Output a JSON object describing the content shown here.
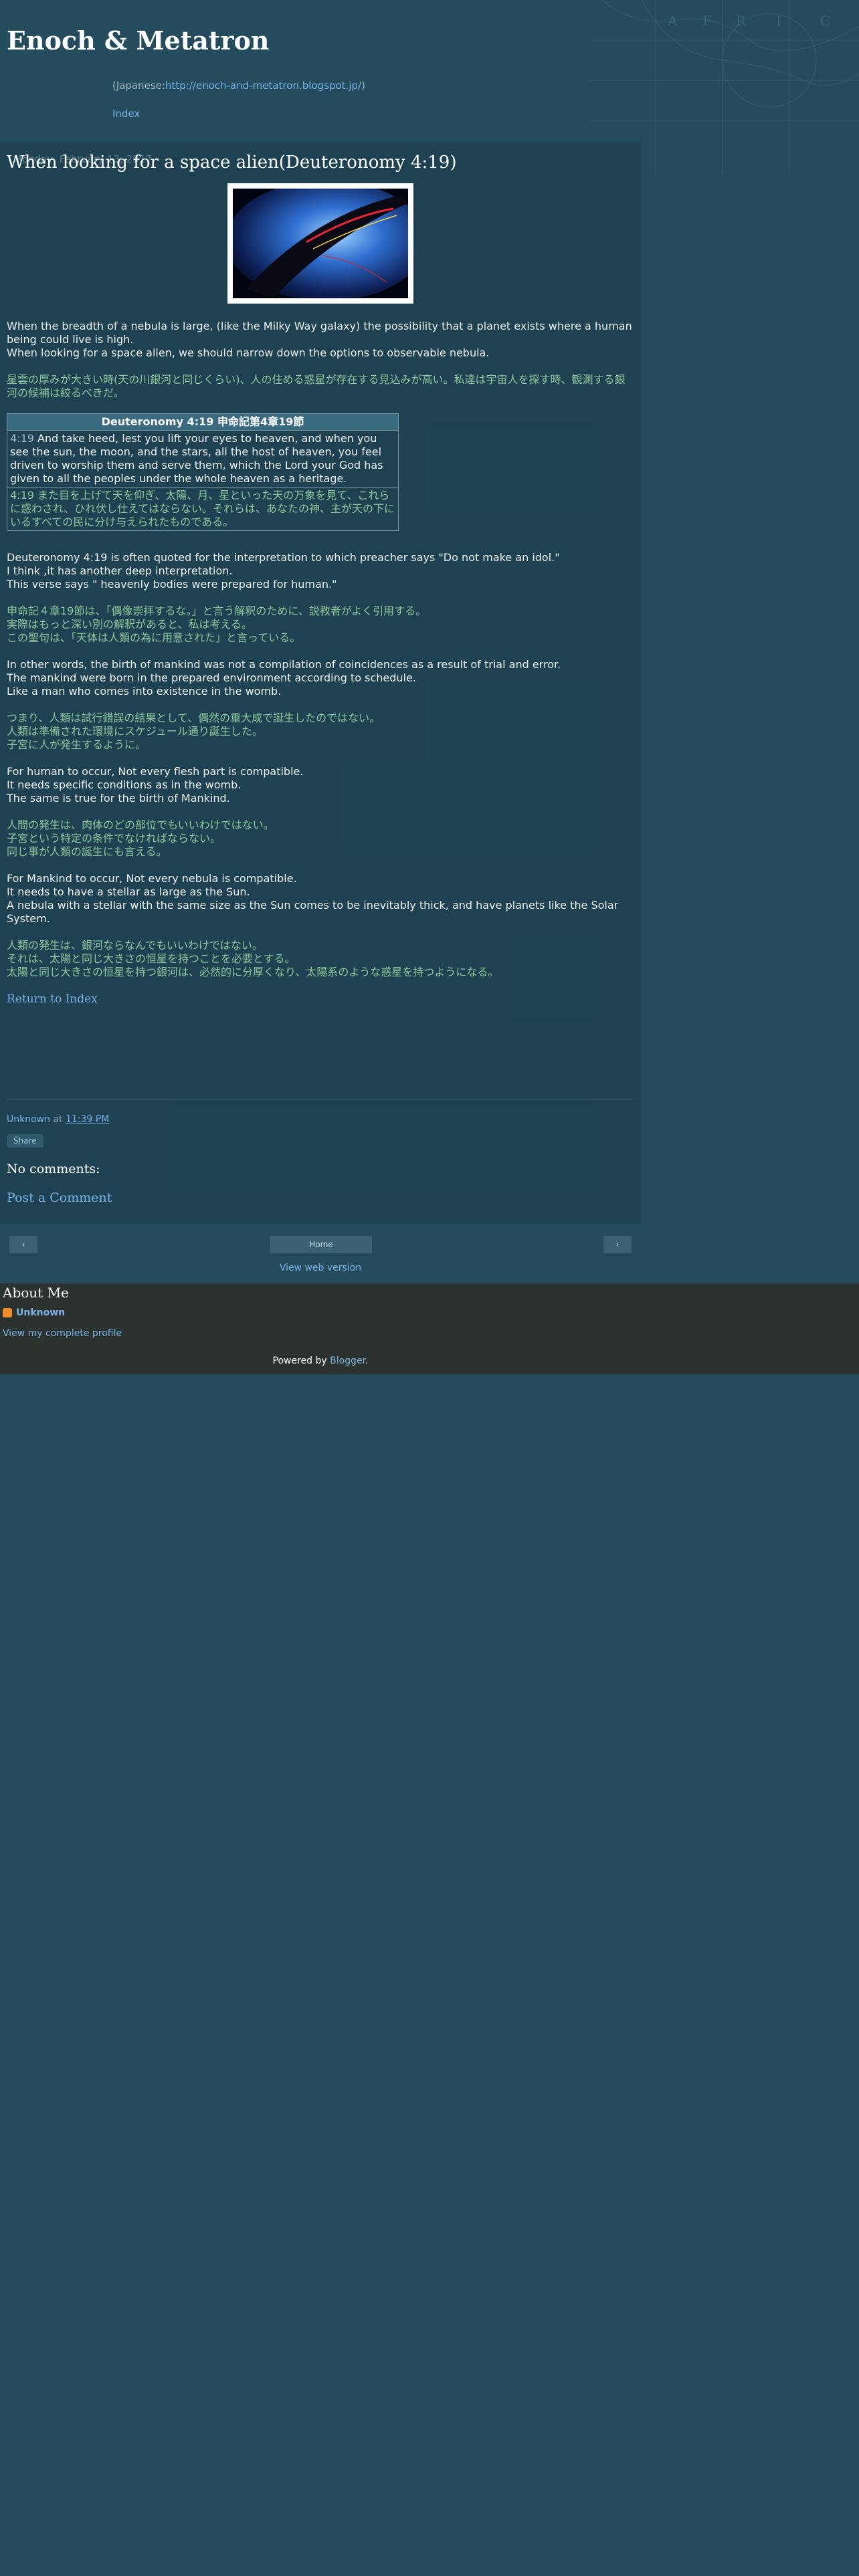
{
  "header": {
    "title": "Enoch & Metatron",
    "desc_prefix": "(Japanese:",
    "desc_link": "http://enoch-and-metatron.blogspot.jp/",
    "desc_suffix": ")",
    "index": "Index"
  },
  "date": "Monday, February 13, 2017",
  "post": {
    "title": "When looking for a space alien(Deuteronomy 4:19)",
    "p1": [
      "When the breadth of a nebula is large, (like the Milky Way galaxy) the possibility that a planet exists where a human being could live is high.",
      "When looking for a space alien, we should narrow down the options to observable nebula."
    ],
    "p2": "星雲の厚みが大きい時(天の川銀河と同じくらい)、人の住める惑星が存在する見込みが高い。私達は宇宙人を探す時、観測する銀河の候補は絞るべきだ。",
    "table": {
      "header": "Deuteronomy 4:19  申命記第4章19節",
      "en_num": "4:19",
      "en_text": " And take heed, lest you lift your eyes to heaven, and when you see the sun, the moon, and the stars, all the host of heaven, you feel driven to worship them and serve them, which the Lord your God has given to all the peoples under the whole heaven as a heritage.",
      "jp_num": "4:19",
      "jp_text": " また目を上げて天を仰ぎ、太陽、月、星といった天の万象を見て、これらに惑わされ、ひれ伏し仕えてはならない。それらは、あなたの神、主が天の下にいるすべての民に分け与えられたものである。"
    },
    "p3": [
      "Deuteronomy 4:19 is often quoted for the interpretation to which preacher says \"Do not make an idol.\"",
      "I think ,it has another deep interpretation.",
      "This verse says \" heavenly bodies were prepared for human.\""
    ],
    "p4": [
      "申命記４章19節は、「偶像崇拝するな。」と言う解釈のために、説教者がよく引用する。",
      "実際はもっと深い別の解釈があると、私は考える。",
      "この聖句は、「天体は人類の為に用意された」と言っている。"
    ],
    "p5": [
      "In other words, the birth of mankind was not a compilation of coincidences as a result of trial and error.",
      "The mankind were   born in the prepared environment according to schedule.",
      "Like a man who comes into existence in the womb."
    ],
    "p6": [
      "つまり、人類は試行錯誤の結果として、偶然の重大成で誕生したのではない。",
      "人類は準備された環境にスケジュール通り誕生した。",
      "子宮に人が発生するように。"
    ],
    "p7": [
      "For human to occur, Not every flesh part is compatible.",
      "It needs specific conditions as in the womb.",
      "The same is true for the birth of Mankind."
    ],
    "p8": [
      "人間の発生は、肉体のどの部位でもいいわけではない。",
      "子宮という特定の条件でなければならない。",
      "同じ事が人類の誕生にも言える。"
    ],
    "p9": [
      "For Mankind to occur, Not every nebula is compatible.",
      "It needs to have a stellar as large as the Sun.",
      "A nebula with a stellar with the same size as the Sun comes to be inevitably thick, and have planets like the Solar System."
    ],
    "p10": [
      "人類の発生は、銀河ならなんでもいいわけではない。",
      "それは、太陽と同じ大きさの恒星を持つことを必要とする。",
      "太陽と同じ大きさの恒星を持つ銀河は、必然的に分厚くなり、太陽系のような惑星を持つようになる。"
    ],
    "return": "Return to Index"
  },
  "meta": {
    "author": "Unknown",
    "at": " at ",
    "time": "11:39 PM",
    "share": "Share"
  },
  "comments": {
    "none": "No comments:",
    "post": "Post a Comment"
  },
  "pager": {
    "prev": "‹",
    "home": "Home",
    "next": "›",
    "web_version": "View web version"
  },
  "about": {
    "title": "About Me",
    "name": "Unknown",
    "profile": "View my complete profile"
  },
  "footer": {
    "powered": "Powered by ",
    "blogger": "Blogger",
    "dot": "."
  }
}
